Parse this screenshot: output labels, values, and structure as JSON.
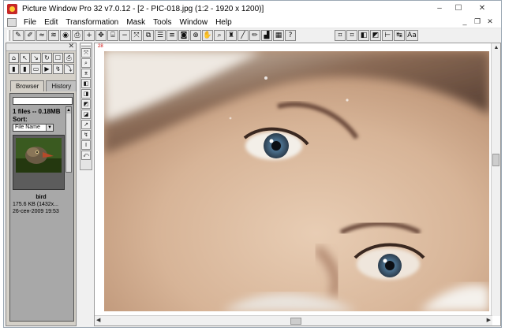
{
  "window": {
    "title": "Picture Window Pro 32  v7.0.12  - [2 - PIC-018.jpg (1:2 - 1920 x 1200)]",
    "controls": {
      "minimize": "–",
      "maximize": "☐",
      "close": "✕"
    }
  },
  "menubar": {
    "items": [
      "File",
      "Edit",
      "Transformation",
      "Mask",
      "Tools",
      "Window",
      "Help"
    ],
    "doc_controls": {
      "minimize": "_",
      "restore": "❐",
      "close": "✕"
    }
  },
  "toolbar": {
    "icons": [
      "pen-icon",
      "brush-icon",
      "wave-icon",
      "zigzag-icon",
      "blob-icon",
      "printer-icon",
      "plus-icon",
      "move-icon",
      "bracket-icon",
      "minus-icon",
      "expand-icon",
      "layers-icon",
      "list-icon",
      "equals-icon",
      "circle-icon",
      "target-icon",
      "hand-icon",
      "magnify-icon",
      "stamp-icon",
      "line-icon",
      "pencil-icon",
      "histogram-icon",
      "grid-icon",
      "help-icon"
    ],
    "glyphs": [
      "✎",
      "✐",
      "≈",
      "≋",
      "◉",
      "⎙",
      "+",
      "✥",
      "⌸",
      "−",
      "⤧",
      "⧉",
      "☰",
      "≡",
      "◙",
      "⊕",
      "✋",
      "⌕",
      "♜",
      "╱",
      "✏",
      "▟",
      "▦",
      "?"
    ],
    "right_glyphs": [
      "⌗",
      "⌗",
      "◧",
      "◩",
      "⊢",
      "↹",
      "Aa"
    ]
  },
  "browser_panel": {
    "tool_glyphs": [
      "⌂",
      "↖",
      "↘",
      "↻",
      "☐",
      "⎙",
      "▮",
      "▮",
      "▭",
      "▶",
      "↯",
      "⤵"
    ],
    "tabs": [
      "Browser",
      "History"
    ],
    "path_value": "",
    "count": "1 files -- 0.18MB",
    "sort_label": "Sort:",
    "sort_value": "File Name",
    "thumbnail": {
      "name": "bird",
      "size": "175.6 KB (1432x...",
      "date": "26-сен-2009 19:53"
    }
  },
  "vertical_toolbar": {
    "glyphs": [
      "⤧",
      "⌕",
      "⌆",
      "◧",
      "◨",
      "◩",
      "◪",
      "↗",
      "↯",
      "I",
      "⤺"
    ]
  },
  "document": {
    "ruler_mark": "28"
  },
  "colors": {
    "window_bg": "#f0f0f0",
    "panel_bg": "#d4d0c8",
    "accent_red": "#c62828"
  }
}
